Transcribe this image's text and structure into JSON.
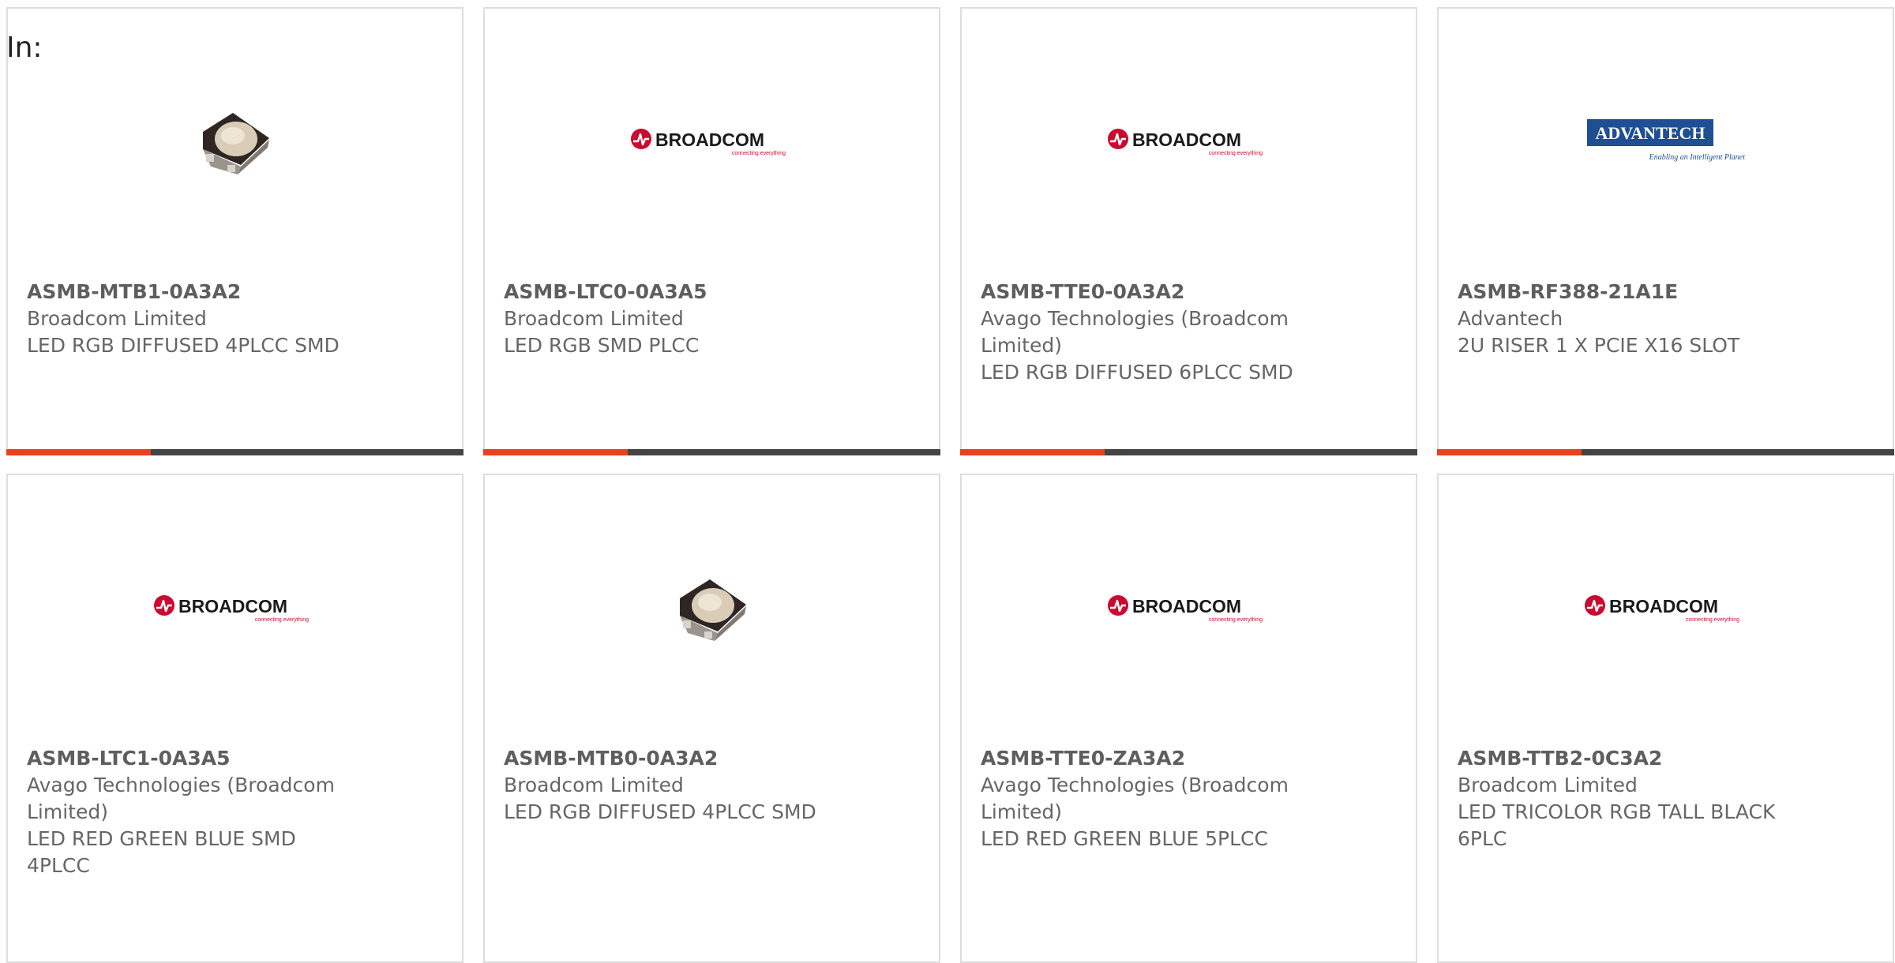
{
  "header": {
    "label": "In:"
  },
  "colors": {
    "accent": "#e8411d",
    "bar": "#444444",
    "broadcom_red": "#cc092f",
    "advantech_blue": "#1e4e93"
  },
  "products": [
    {
      "part": "ASMB-MTB1-0A3A2",
      "manufacturer": "Broadcom Limited",
      "description": "LED RGB DIFFUSED 4PLCC SMD",
      "image": "led-image"
    },
    {
      "part": "ASMB-LTC0-0A3A5",
      "manufacturer": "Broadcom Limited",
      "description": "LED RGB SMD PLCC",
      "image": "broadcom-logo"
    },
    {
      "part": "ASMB-TTE0-0A3A2",
      "manufacturer": "Avago Technologies (Broadcom Limited)",
      "description": "LED RGB DIFFUSED 6PLCC SMD",
      "image": "broadcom-logo"
    },
    {
      "part": "ASMB-RF388-21A1E",
      "manufacturer": "Advantech",
      "description": "2U RISER 1 X PCIE X16 SLOT",
      "image": "advantech-logo"
    },
    {
      "part": "ASMB-LTC1-0A3A5",
      "manufacturer": "Avago Technologies (Broadcom Limited)",
      "description": "LED RED GREEN BLUE SMD 4PLCC",
      "image": "broadcom-logo"
    },
    {
      "part": "ASMB-MTB0-0A3A2",
      "manufacturer": "Broadcom Limited",
      "description": "LED RGB DIFFUSED 4PLCC SMD",
      "image": "led-image"
    },
    {
      "part": "ASMB-TTE0-ZA3A2",
      "manufacturer": "Avago Technologies (Broadcom Limited)",
      "description": "LED RED GREEN BLUE 5PLCC",
      "image": "broadcom-logo"
    },
    {
      "part": "ASMB-TTB2-0C3A2",
      "manufacturer": "Broadcom Limited",
      "description": "LED TRICOLOR RGB TALL BLACK 6PLC",
      "image": "broadcom-logo"
    }
  ],
  "logos": {
    "broadcom": {
      "name": "BROADCOM",
      "tagline": "connecting everything"
    },
    "advantech": {
      "name": "ADVANTECH",
      "tagline": "Enabling an Intelligent Planet"
    }
  }
}
